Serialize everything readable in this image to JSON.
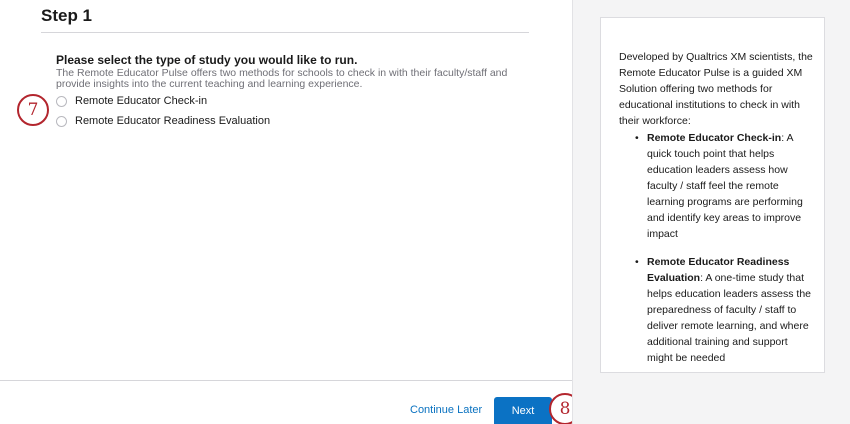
{
  "step": {
    "title": "Step 1"
  },
  "study_selection": {
    "question": "Please select the type of study you would like to run.",
    "description": "The Remote Educator Pulse offers two methods for schools to check in with their faculty/staff and provide insights into the current teaching and learning experience.",
    "options": [
      {
        "label": "Remote Educator Check-in",
        "selected": false
      },
      {
        "label": "Remote Educator Readiness Evaluation",
        "selected": false
      }
    ]
  },
  "callouts": {
    "first": "7",
    "second": "8"
  },
  "footer": {
    "continue_later": "Continue Later",
    "next": "Next"
  },
  "info_panel": {
    "intro": "Developed by Qualtrics XM scientists, the Remote Educator Pulse is a guided XM Solution offering two methods for educational institutions to check in with their workforce:",
    "items": [
      {
        "term": "Remote Educator Check-in",
        "text": ": A quick touch point that helps education leaders assess how faculty / staff feel the remote learning programs are performing and identify key areas to improve impact"
      },
      {
        "term": "Remote Educator Readiness Evaluation",
        "text": ": A one-time study that helps education leaders assess the preparedness of faculty / staff to deliver remote learning, and where additional training and support might be needed"
      }
    ]
  },
  "colors": {
    "primary": "#0b72c4",
    "link": "#0a72c0",
    "callout": "#b3262e",
    "sidebar_bg": "#f4f4f5"
  }
}
